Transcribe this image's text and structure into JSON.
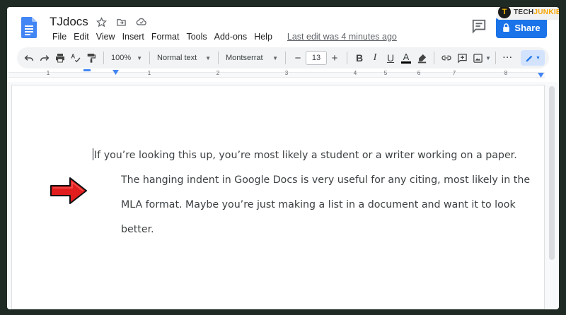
{
  "app": {
    "doc_title": "TJdocs",
    "last_edit": "Last edit was 4 minutes ago",
    "share_label": "Share"
  },
  "menu": [
    "File",
    "Edit",
    "View",
    "Insert",
    "Format",
    "Tools",
    "Add-ons",
    "Help"
  ],
  "toolbar": {
    "zoom": "100%",
    "style": "Normal text",
    "font": "Montserrat",
    "font_size": "13",
    "minus": "−",
    "plus": "+",
    "bold": "B",
    "italic": "I",
    "underline": "U",
    "text_color": "A",
    "more": "···"
  },
  "ruler": {
    "numbers": [
      "1",
      "1",
      "2",
      "3",
      "4",
      "5",
      "6",
      "7",
      "8"
    ]
  },
  "document": {
    "paragraph": "If you’re looking this up, you’re most likely a student or a writer working on a paper. The hanging indent in Google Docs is very useful for any citing, most likely in the MLA format. Maybe you’re just making a list in a document and want it to look better."
  },
  "watermark": {
    "logo_letter": "T",
    "tech": "TECH",
    "junkie": "JUNKIE"
  },
  "colors": {
    "share_blue": "#1a73e8",
    "arrow_red": "#e11d1d",
    "doc_blue": "#4285f4"
  }
}
